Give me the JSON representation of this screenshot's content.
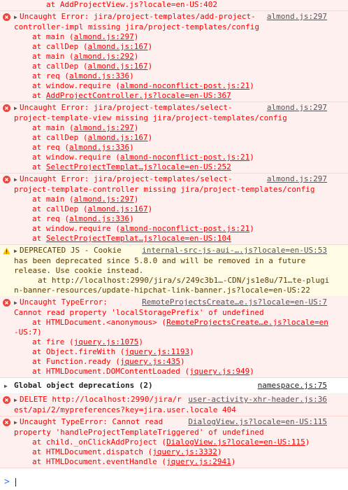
{
  "top_frame": {
    "prefix": "at ",
    "link": "AddProjectView.js?locale=en-US:402"
  },
  "messages": [
    {
      "level": "error",
      "header": "Uncaught Error: jira/project-templates/add-project-controller-impl missing jira/project-templates/config",
      "header_lines": [
        "Uncaught Error: jira/project-templates/add-project-",
        "controller-impl missing jira/project-templates/config"
      ],
      "source": "almond.js:297",
      "frames": [
        [
          "at main (",
          "almond.js:297",
          ")"
        ],
        [
          "at callDep (",
          "almond.js:167",
          ")"
        ],
        [
          "at main (",
          "almond.js:292",
          ")"
        ],
        [
          "at callDep (",
          "almond.js:167",
          ")"
        ],
        [
          "at req (",
          "almond.js:336",
          ")"
        ],
        [
          "at window.require (",
          "almond-noconflict-post.js:21",
          ")"
        ],
        [
          "at ",
          "AddProjectController.js?locale=en-US:367",
          ""
        ]
      ]
    },
    {
      "level": "error",
      "header_lines": [
        "Uncaught Error: jira/project-templates/select-",
        "project-template-view missing jira/project-templates/config"
      ],
      "source": "almond.js:297",
      "frames": [
        [
          "at main (",
          "almond.js:297",
          ")"
        ],
        [
          "at callDep (",
          "almond.js:167",
          ")"
        ],
        [
          "at req (",
          "almond.js:336",
          ")"
        ],
        [
          "at window.require (",
          "almond-noconflict-post.js:21",
          ")"
        ],
        [
          "at ",
          "SelectProjectTemplat…js?locale=en-US:252",
          ""
        ]
      ]
    },
    {
      "level": "error",
      "header_lines": [
        "Uncaught Error: jira/project-templates/select-",
        "project-template-controller missing jira/project-templates/config"
      ],
      "source": "almond.js:297",
      "frames": [
        [
          "at main (",
          "almond.js:297",
          ")"
        ],
        [
          "at callDep (",
          "almond.js:167",
          ")"
        ],
        [
          "at req (",
          "almond.js:336",
          ")"
        ],
        [
          "at window.require (",
          "almond-noconflict-post.js:21",
          ")"
        ],
        [
          "at ",
          "SelectProjectTemplat…js?locale=en-US:104",
          ""
        ]
      ]
    }
  ],
  "warning": {
    "title": "DEPRECATED JS - Cookie",
    "source": "internal-src-js-aui-….js?locale=en-US:53",
    "lines": [
      "has been deprecated since 5.8.0 and will be removed in a future",
      "release. Use cookie instead."
    ],
    "at_prefix": "at ",
    "at_link_1": "http://localhost:2990/jira/s/249c3b1…-CDN/js1e8u/71…te-plugi",
    "at_link_2": "n-banner-resources/update-hipchat-link-banner.js?locale=en-US:22"
  },
  "type_error": {
    "title": "Uncaught TypeError:",
    "source": "RemoteProjectsCreate…e.js?locale=en-US:7",
    "lines": [
      "Cannot read property 'localStoragePrefix' of undefined"
    ],
    "frame1_prefix": "at HTMLDocument.<anonymous> (",
    "frame1_link_a": "RemoteProjectsCreate…e.js?locale=en",
    "frame1_link_b": "-US:7",
    "frame1_suffix": ")",
    "frames": [
      [
        "at fire (",
        "jquery.js:1075",
        ")"
      ],
      [
        "at Object.fireWith (",
        "jquery.js:1193",
        ")"
      ],
      [
        "at Function.ready (",
        "jquery.js:435",
        ")"
      ],
      [
        "at HTMLDocument.DOMContentLoaded (",
        "jquery.js:949",
        ")"
      ]
    ]
  },
  "group": {
    "label": "Global object deprecations (2)",
    "source": "namespace.js:75"
  },
  "delete": {
    "method": "DELETE",
    "url_1": "http://localhost:2990/jira/r",
    "source": "user-activity-xhr-header.js:36",
    "url_2": "est/api/2/mypreferences?key=jira.user.locale",
    "status": "404"
  },
  "type_error_2": {
    "title": "Uncaught TypeError: Cannot read",
    "source": "DialogView.js?locale=en-US:115",
    "line2": "property 'handleProjectTemplateTriggered' of undefined",
    "frames": [
      [
        "at child._onClickAddProject (",
        "DialogView.js?locale=en-US:115",
        ")"
      ],
      [
        "at HTMLDocument.dispatch (",
        "jquery.js:3332",
        ")"
      ],
      [
        "at HTMLDocument.eventHandle (",
        "jquery.js:2941",
        ")"
      ]
    ]
  },
  "prompt_symbol": ">",
  "colors": {
    "error_bg": "#fff0f0",
    "error_text": "#ff0000",
    "warn_bg": "#fffbe5",
    "warn_text": "#5c3c00",
    "prompt": "#367cf1"
  },
  "icons": {
    "error": "error-circle-icon",
    "warning": "warning-triangle-icon",
    "expand": "expand-triangle-icon"
  }
}
